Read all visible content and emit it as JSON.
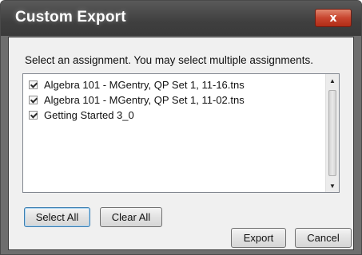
{
  "window": {
    "title": "Custom Export",
    "close_label": "x"
  },
  "instruction": "Select an assignment. You may select multiple assignments.",
  "assignments": [
    {
      "label": "Algebra 101 - MGentry, QP Set 1, 11-16.tns",
      "checked": true
    },
    {
      "label": "Algebra 101 - MGentry, QP Set 1, 11-02.tns",
      "checked": true
    },
    {
      "label": "Getting Started 3_0",
      "checked": true
    }
  ],
  "scrollbar": {
    "up_icon": "▲",
    "down_icon": "▼"
  },
  "buttons": {
    "select_all": "Select All",
    "clear_all": "Clear All",
    "export": "Export",
    "cancel": "Cancel"
  },
  "colors": {
    "titlebar": "#3f3f3f",
    "close_button": "#c8452f",
    "dialog_body": "#f0f0f0"
  }
}
